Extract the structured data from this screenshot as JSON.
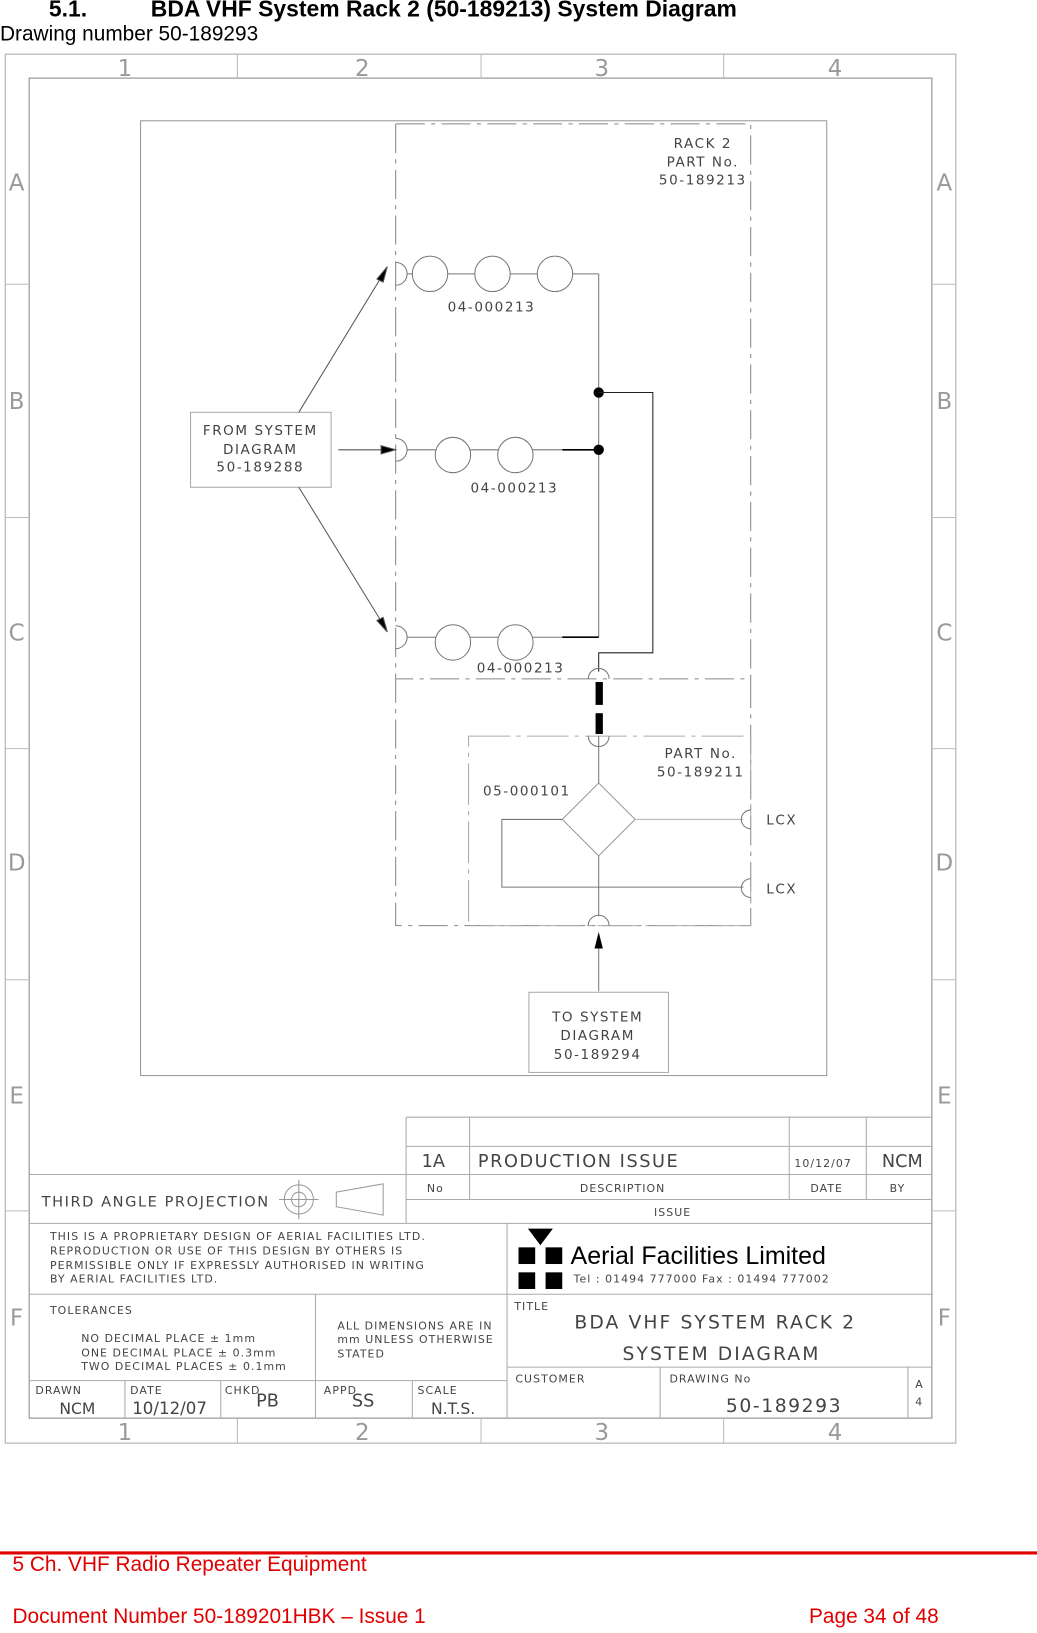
{
  "heading": {
    "number": "5.1.",
    "title": "BDA VHF System Rack 2 (50-189213) System Diagram",
    "drawing_number_line": "Drawing number 50-189293"
  },
  "frame": {
    "columns": [
      "1",
      "2",
      "3",
      "4"
    ],
    "rows": [
      "A",
      "B",
      "C",
      "D",
      "E",
      "F"
    ]
  },
  "diagram": {
    "rack2": {
      "line1": "RACK  2",
      "line2": "PART  No.",
      "line3": "50-189213"
    },
    "filter_labels": [
      "04-000213",
      "04-000213",
      "04-000213"
    ],
    "from_box": {
      "line1": "FROM  SYSTEM",
      "line2": "DIAGRAM",
      "line3": "50-189288"
    },
    "lower": {
      "line1": "PART  No.",
      "line2": "50-189211",
      "splitter": "05-000101",
      "lcx1": "LCX",
      "lcx2": "LCX"
    },
    "to_box": {
      "line1": "TO  SYSTEM",
      "line2": "DIAGRAM",
      "line3": "50-189294"
    }
  },
  "title_block": {
    "issue": {
      "no": "1A",
      "description": "PRODUCTION  ISSUE",
      "date": "10/12/07",
      "by": "NCM",
      "h_no": "No",
      "h_desc": "DESCRIPTION",
      "h_date": "DATE",
      "h_by": "BY",
      "label": "ISSUE"
    },
    "projection": "THIRD  ANGLE  PROJECTION",
    "proprietary": [
      "THIS  IS  A  PROPRIETARY  DESIGN  OF  AERIAL  FACILITIES  LTD.",
      "REPRODUCTION  OR  USE  OF  THIS  DESIGN  BY  OTHERS  IS",
      "PERMISSIBLE  ONLY  IF  EXPRESSLY  AUTHORISED  IN  WRITING",
      "BY  AERIAL  FACILITIES  LTD."
    ],
    "company": {
      "name": "Aerial Facilities Limited",
      "contact": "Tel  :  01494  777000  Fax  :  01494  777002"
    },
    "tolerances": {
      "label": "TOLERANCES",
      "lines": [
        "NO  DECIMAL  PLACE  ±  1mm",
        "ONE  DECIMAL  PLACE  ±  0.3mm",
        "TWO  DECIMAL  PLACES  ±  0.1mm"
      ]
    },
    "dimensions": [
      "ALL  DIMENSIONS  ARE  IN",
      "mm  UNLESS  OTHERWISE",
      "STATED"
    ],
    "title_label": "TITLE",
    "title1": "BDA  VHF  SYSTEM  RACK  2",
    "title2": "SYSTEM  DIAGRAM",
    "drawn_label": "DRAWN",
    "drawn": "NCM",
    "date_label": "DATE",
    "date": "10/12/07",
    "chkd_label": "CHKD",
    "chkd": "PB",
    "appd_label": "APPD",
    "appd": "SS",
    "scale_label": "SCALE",
    "scale": "N.T.S.",
    "customer_label": "CUSTOMER",
    "drawing_no_label": "DRAWING  No",
    "drawing_no": "50-189293",
    "size1": "A",
    "size2": "4"
  },
  "footer": {
    "left1": "5 Ch. VHF Radio Repeater Equipment",
    "left2": "Document Number 50-189201HBK – Issue 1",
    "right": "Page 34 of 48",
    "color": "#e00000"
  }
}
